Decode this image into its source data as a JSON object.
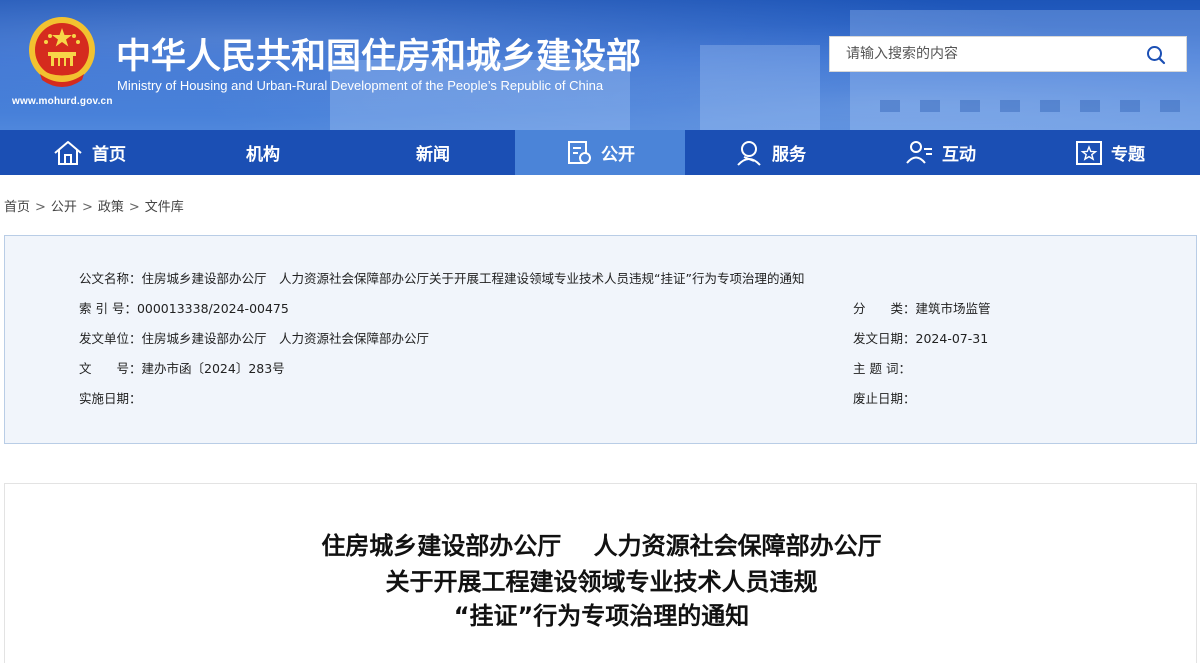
{
  "header": {
    "site_url": "www.mohurd.gov.cn",
    "title_cn": "中华人民共和国住房和城乡建设部",
    "title_en": "Ministry of Housing and Urban-Rural Development of the People’s Republic of China",
    "search_placeholder": "请输入搜索的内容",
    "brand_color": "#1b4fb4",
    "active_color": "#4b84d8"
  },
  "nav": {
    "items": [
      {
        "label": "首页",
        "icon": "home-icon"
      },
      {
        "label": "机构",
        "icon": ""
      },
      {
        "label": "新闻",
        "icon": ""
      },
      {
        "label": "公开",
        "icon": "document-icon",
        "active": true
      },
      {
        "label": "服务",
        "icon": "service-icon"
      },
      {
        "label": "互动",
        "icon": "interaction-icon"
      },
      {
        "label": "专题",
        "icon": "star-box-icon"
      }
    ]
  },
  "breadcrumb": [
    "首页",
    "公开",
    "政策",
    "文件库"
  ],
  "meta": {
    "doc_name_label": "公文名称：",
    "doc_name": "住房城乡建设部办公厅　人力资源社会保障部办公厅关于开展工程建设领域专业技术人员违规“挂证”行为专项治理的通知",
    "index_label": "索 引 号：",
    "index": "000013338/2024-00475",
    "category_label": "分　　类：",
    "category": "建筑市场监管",
    "issuer_label": "发文单位：",
    "issuer": "住房城乡建设部办公厅　人力资源社会保障部办公厅",
    "issue_date_label": "发文日期：",
    "issue_date": "2024-07-31",
    "doc_no_label": "文　　号：",
    "doc_no": "建办市函〔2024〕283号",
    "keywords_label": "主 题 词：",
    "keywords": "",
    "effective_label": "实施日期：",
    "effective": "",
    "expire_label": "废止日期：",
    "expire": ""
  },
  "article": {
    "title_line1": "住房城乡建设部办公厅　 人力资源社会保障部办公厅",
    "title_line2": "关于开展工程建设领域专业技术人员违规",
    "title_line3": "“挂证”行为专项治理的通知"
  }
}
